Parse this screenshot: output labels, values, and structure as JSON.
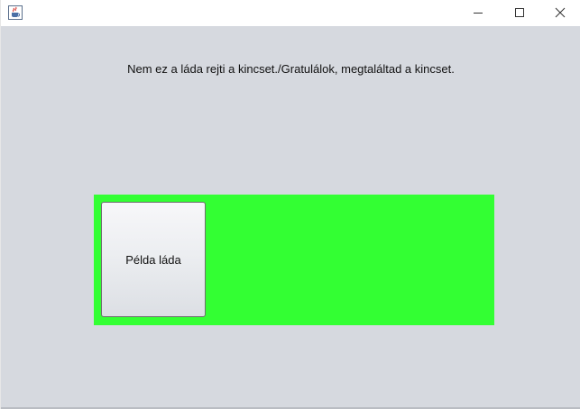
{
  "window": {
    "icon": "java-coffee-cup-icon",
    "controls": {
      "minimize": "minimize-icon",
      "maximize": "maximize-icon",
      "close": "close-icon"
    }
  },
  "main": {
    "message": "Nem ez a láda rejti a kincset./Gratulálok, megtaláltad a kincset.",
    "panel_color": "#33ff33",
    "chest_button_label": "Példa láda"
  }
}
